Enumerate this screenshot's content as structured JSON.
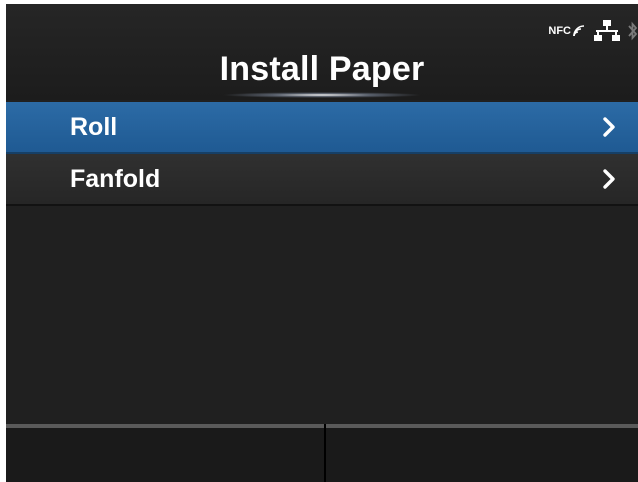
{
  "header": {
    "title": "Install Paper",
    "status_icons": {
      "nfc_label": "NFC",
      "icons": [
        "nfc-icon",
        "network-icon",
        "bluetooth-icon"
      ]
    }
  },
  "menu": {
    "items": [
      {
        "label": "Roll",
        "selected": true,
        "icon": "chevron-right-icon"
      },
      {
        "label": "Fanfold",
        "selected": false,
        "icon": "chevron-right-icon"
      }
    ]
  },
  "softkeys": {
    "left_label": "",
    "right_label": ""
  },
  "colors": {
    "background": "#202020",
    "selected": "#1f5a93",
    "text": "#ffffff",
    "softkey_border": "#5a5a5a"
  }
}
